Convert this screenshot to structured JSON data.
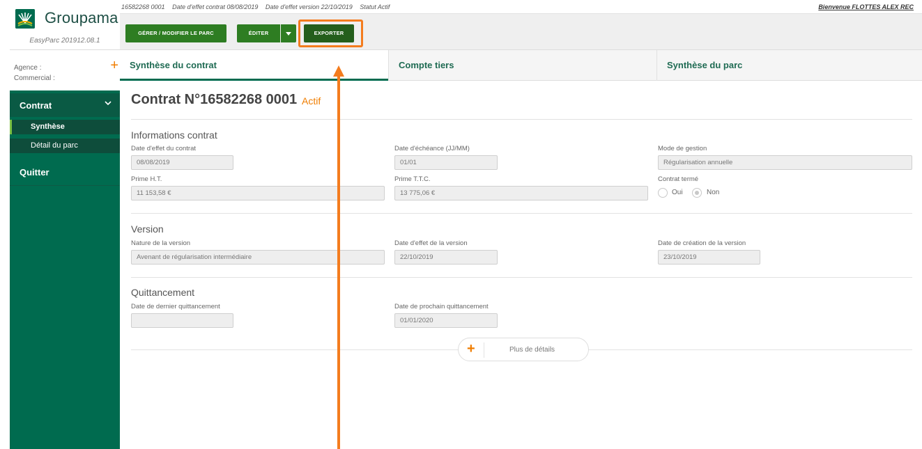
{
  "brand": {
    "name": "Groupama",
    "version": "EasyParc 201912.08.1"
  },
  "agency": {
    "agence_label": "Agence :",
    "commercial_label": "Commercial :"
  },
  "sidebar": {
    "contrat": "Contrat",
    "items": [
      "Synthèse",
      "Détail du parc"
    ],
    "quitter": "Quitter"
  },
  "infobar": {
    "contract_no": "16582268 0001",
    "date_effet_contrat": "Date d'effet contrat 08/08/2019",
    "date_effet_version": "Date d'effet version 22/10/2019",
    "statut": "Statut Actif",
    "welcome": "Bienvenue FLOTTES ALEX REC"
  },
  "toolbar": {
    "gerer": "GÉRER / MODIFIER LE PARC",
    "editer": "ÉDITER",
    "exporter": "EXPORTER"
  },
  "tabs": [
    "Synthèse du contrat",
    "Compte tiers",
    "Synthèse du parc"
  ],
  "contract": {
    "title": "Contrat N°16582268 0001",
    "status": "Actif"
  },
  "informations": {
    "title": "Informations contrat",
    "date_effet_label": "Date d'effet du contrat",
    "date_effet_value": "08/08/2019",
    "date_echeance_label": "Date d'échéance (JJ/MM)",
    "date_echeance_value": "01/01",
    "mode_gestion_label": "Mode de gestion",
    "mode_gestion_value": "Régularisation annuelle",
    "prime_ht_label": "Prime H.T.",
    "prime_ht_value": "11 153,58 €",
    "prime_ttc_label": "Prime T.T.C.",
    "prime_ttc_value": "13 775,06 €",
    "contrat_terme_label": "Contrat termé",
    "oui": "Oui",
    "non": "Non"
  },
  "version": {
    "title": "Version",
    "nature_label": "Nature de la version",
    "nature_value": "Avenant de régularisation intermédiaire",
    "date_effet_label": "Date d'effet de la version",
    "date_effet_value": "22/10/2019",
    "date_creation_label": "Date de création de la version",
    "date_creation_value": "23/10/2019"
  },
  "quittancement": {
    "title": "Quittancement",
    "dernier_label": "Date de dernier quittancement",
    "dernier_value": "",
    "prochain_label": "Date de prochain quittancement",
    "prochain_value": "01/01/2020"
  },
  "more_details": "Plus de détails",
  "colors": {
    "brand_green": "#006b4f",
    "button_green": "#2e7d22",
    "accent_orange": "#f07d00",
    "annotation_orange": "#f47c1e"
  }
}
